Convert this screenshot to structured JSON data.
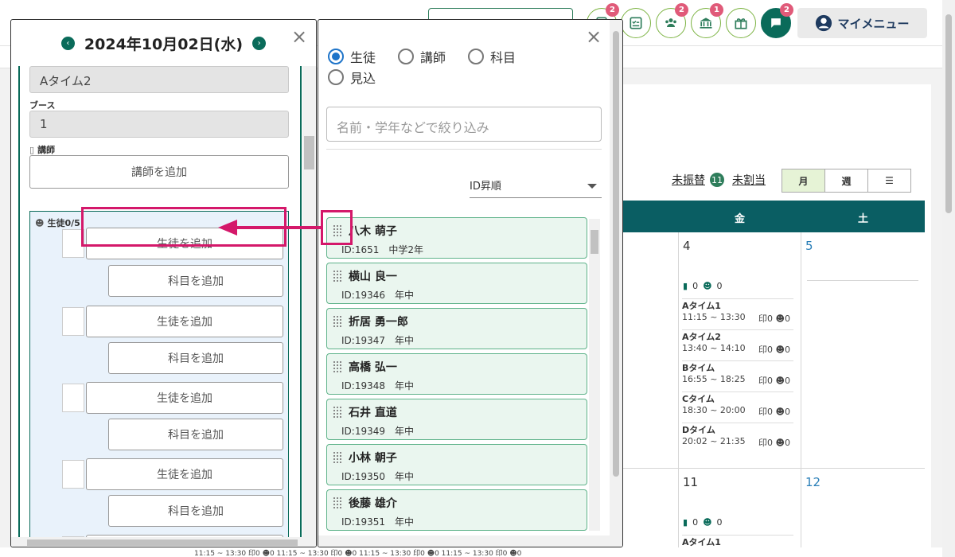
{
  "colors": {
    "accent": "#0a6b5a",
    "highlight": "#d4186a",
    "badge": "#e05a79",
    "radio": "#1e74c9",
    "card_border": "#5fb38a"
  },
  "topbar": {
    "icons": [
      {
        "name": "badge-icon",
        "badge": "2"
      },
      {
        "name": "checklist-icon",
        "badge": ""
      },
      {
        "name": "people-icon",
        "badge": "2"
      },
      {
        "name": "bank-icon",
        "badge": "1"
      },
      {
        "name": "gift-icon",
        "badge": ""
      },
      {
        "name": "chat-icon",
        "badge": "2"
      }
    ],
    "mymenu_label": "マイメニュー"
  },
  "calendar": {
    "links": {
      "unassigned_transfer": "未振替",
      "unassigned_transfer_count": "11",
      "unassigned": "未割当"
    },
    "views": {
      "month": "月",
      "week": "週",
      "list": "☰"
    },
    "header": {
      "fri": "金",
      "sat": "土"
    },
    "days": {
      "d4": "4",
      "d5": "5",
      "d11": "11",
      "d12": "12"
    },
    "mini_counts": {
      "teacher": "0",
      "student": "0"
    },
    "slots": [
      {
        "name": "Aタイム1",
        "time": "11:15 ~ 13:30"
      },
      {
        "name": "Aタイム2",
        "time": "13:40 ~ 14:10"
      },
      {
        "name": "Bタイム",
        "time": "16:55 ~ 18:25"
      },
      {
        "name": "Cタイム",
        "time": "18:30 ~ 20:00"
      },
      {
        "name": "Dタイム",
        "time": "20:02 ~ 21:35"
      }
    ],
    "slot_counts": "0",
    "bottom_slot": {
      "name": "Aタイム1",
      "time": "11:15 ~ 13:30"
    },
    "bottom_strip": "11:15 ~ 13:30  印0 ☻0    11:15 ~ 13:30  印0 ☻0    11:15 ~ 13:30  印0 ☻0    11:15 ~ 13:30  印0 ☻0"
  },
  "left_modal": {
    "prev": "‹",
    "next": "›",
    "date_title": "2024年10月02日(水)",
    "close": "×",
    "time_value": "Aタイム2",
    "booth_label": "ブース",
    "booth_value": "1",
    "teacher_label": "講師",
    "add_teacher": "講師を追加",
    "students_label": "生徒0/5",
    "add_student": "生徒を追加",
    "add_subject": "科目を追加"
  },
  "right_modal": {
    "close": "×",
    "radios": {
      "student": "生徒",
      "teacher": "講師",
      "subject": "科目",
      "prospect": "見込"
    },
    "search_placeholder": "名前・学年などで絞り込み",
    "sort_label": "ID昇順",
    "students": [
      {
        "name": "八木 萌子",
        "sub": "ID:1651　中学2年"
      },
      {
        "name": "横山 良一",
        "sub": "ID:19346　年中"
      },
      {
        "name": "折居 勇一郎",
        "sub": "ID:19347　年中"
      },
      {
        "name": "高橋 弘一",
        "sub": "ID:19348　年中"
      },
      {
        "name": "石井 直道",
        "sub": "ID:19349　年中"
      },
      {
        "name": "小林 朝子",
        "sub": "ID:19350　年中"
      },
      {
        "name": "後藤 雄介",
        "sub": "ID:19351　年中"
      }
    ]
  }
}
